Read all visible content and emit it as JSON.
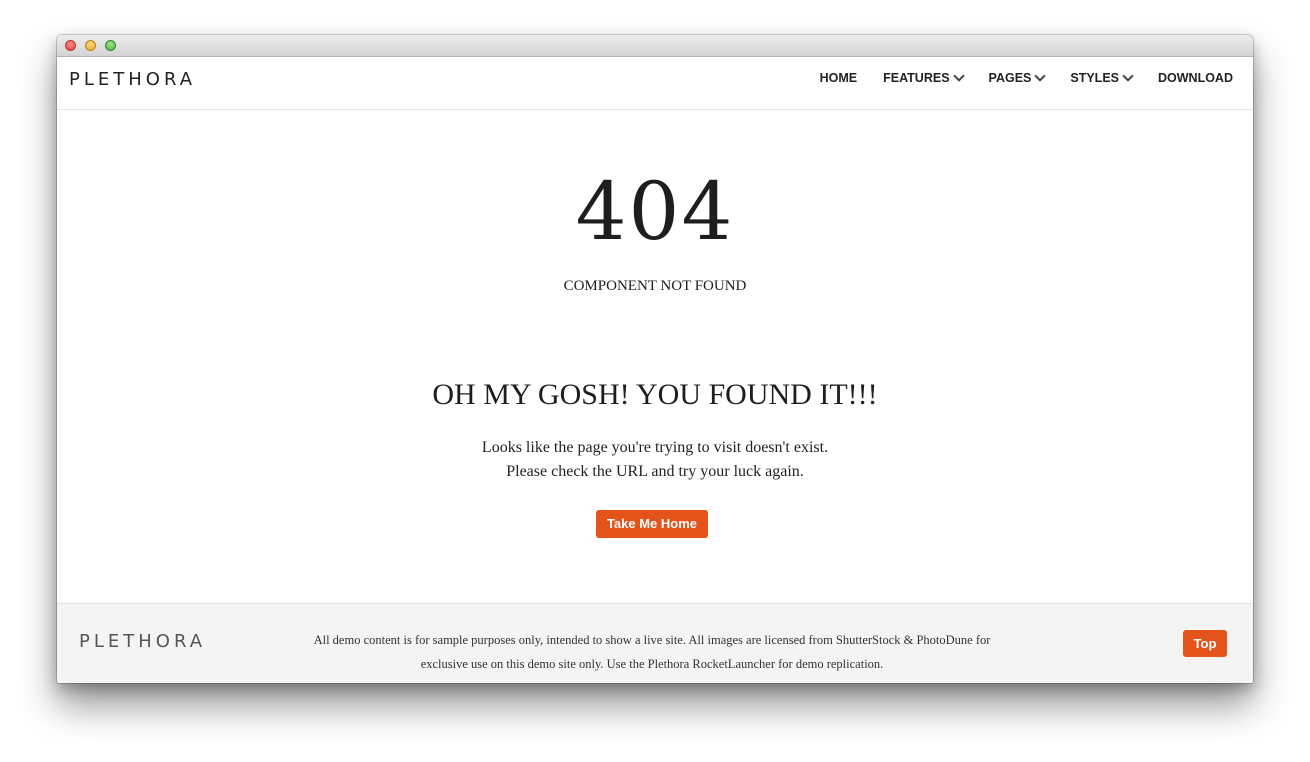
{
  "navbar": {
    "logo": "PLETHORA",
    "items": [
      {
        "label": "HOME",
        "has_dropdown": false
      },
      {
        "label": "FEATURES",
        "has_dropdown": true
      },
      {
        "label": "PAGES",
        "has_dropdown": true
      },
      {
        "label": "STYLES",
        "has_dropdown": true
      },
      {
        "label": "DOWNLOAD",
        "has_dropdown": false
      }
    ],
    "dropdown_icon": "chevron-down-icon"
  },
  "main": {
    "error_code": "404",
    "error_subtitle": "COMPONENT NOT FOUND",
    "headline": "OH MY GOSH! YOU FOUND IT!!!",
    "message_line1": "Looks like the page you're trying to visit doesn't exist.",
    "message_line2": "Please check the URL and try your luck again.",
    "home_button_label": "Take Me Home"
  },
  "footer": {
    "logo": "PLETHORA",
    "text_line1": "All demo content is for sample purposes only, intended to show a live site. All images are licensed from ShutterStock & PhotoDune for",
    "text_line2": "exclusive use on this demo site only. Use the Plethora RocketLauncher for demo replication.",
    "top_button_label": "Top"
  },
  "colors": {
    "accent": "#e3531a",
    "text": "#222222",
    "footer_bg": "#f4f4f4"
  }
}
